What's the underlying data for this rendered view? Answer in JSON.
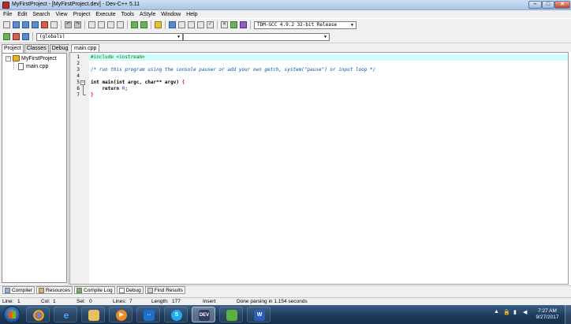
{
  "window": {
    "title": "MyFirstProject - [MyFirstProject.dev] - Dev-C++ 5.11",
    "minimize": "–",
    "maximize": "□",
    "close": "✕"
  },
  "menu": [
    "File",
    "Edit",
    "Search",
    "View",
    "Project",
    "Execute",
    "Tools",
    "AStyle",
    "Window",
    "Help"
  ],
  "toolbar": {
    "compiler_combo": "TDM-GCC 4.9.2 32-bit Release",
    "scope_combo": "(globals)"
  },
  "left_panel": {
    "tabs": [
      "Project",
      "Classes",
      "Debug"
    ],
    "active_tab": "Project",
    "tree": {
      "project": "MyFirstProject",
      "files": [
        "main.cpp"
      ]
    }
  },
  "editor": {
    "tab": "main.cpp",
    "line_numbers": [
      "1",
      "2",
      "3",
      "4",
      "5",
      "6",
      "7"
    ],
    "lines": [
      {
        "kind": "pp",
        "text": "#include <iostream>"
      },
      {
        "kind": "blank",
        "text": ""
      },
      {
        "kind": "comment",
        "text": "/* run this program using the console pauser or add your own getch, system(\"pause\") or input loop */"
      },
      {
        "kind": "blank",
        "text": ""
      },
      {
        "kind": "code",
        "part1": "int main(int argc, char** argv) ",
        "part2": "{"
      },
      {
        "kind": "code",
        "part1": "    return ",
        "part2": "0",
        "part3": ";"
      },
      {
        "kind": "code",
        "part1": "",
        "part2": "}"
      }
    ]
  },
  "bottom_tabs": [
    "Compiler",
    "Resources",
    "Compile Log",
    "Debug",
    "Find Results"
  ],
  "status": {
    "line_label": "Line:",
    "line_value": "1",
    "col_label": "Col:",
    "col_value": "1",
    "sel_label": "Sel:",
    "sel_value": "0",
    "lines_label": "Lines:",
    "lines_value": "7",
    "length_label": "Length:",
    "length_value": "177",
    "mode": "Insert",
    "message": "Done parsing in 1.154 seconds"
  },
  "taskbar": {
    "apps": [
      "start-icon",
      "chrome-icon",
      "ie-icon",
      "explorer-icon",
      "media-player-icon",
      "teamviewer-icon",
      "skype-icon",
      "devcpp-icon",
      "chart-icon",
      "word-icon"
    ],
    "active_app_label": "DEV",
    "time": "7:27 AM",
    "date": "9/27/2017"
  }
}
